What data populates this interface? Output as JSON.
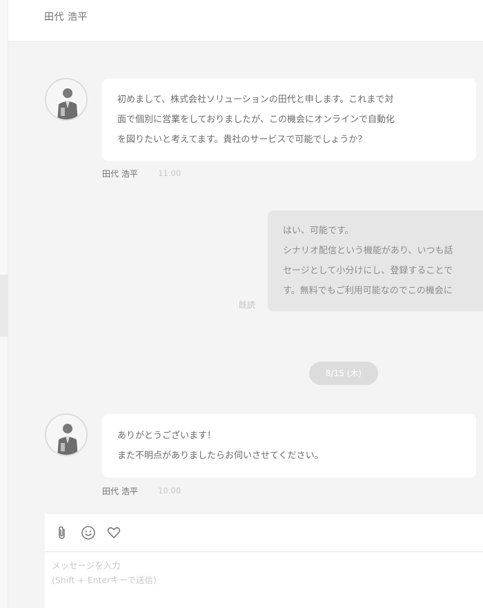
{
  "header": {
    "title": "田代 浩平"
  },
  "messages": [
    {
      "direction": "incoming",
      "lines": [
        "初めまして、株式会社ソリューションの田代と申します。これまで対",
        "面で個別に営業をしておりましたが、この機会にオンラインで自動化",
        "を図りたいと考えてます。貴社のサービスで可能でしょうか？"
      ],
      "sender": "田代 浩平",
      "time": "11:00"
    },
    {
      "direction": "outgoing",
      "lines": [
        "はい、可能です。",
        "シナリオ配信という機能があり、いつも話",
        "セージとして小分けにし、登録することで",
        "す。無料でもご利用可能なのでこの機会に"
      ],
      "read_label": "既読"
    },
    {
      "direction": "incoming",
      "lines": [
        "ありがとうございます！",
        "また不明点がありましたらお伺いさせてください。"
      ],
      "sender": "田代 浩平",
      "time": "10:00"
    }
  ],
  "date_separator": "8/15 (木)",
  "composer": {
    "placeholder": "メッセージを入力\n(Shift + Enterキーで送信)",
    "value": "",
    "icons": [
      "paperclip-icon",
      "smiley-icon",
      "heart-icon"
    ]
  },
  "colors": {
    "background": "#f4f4f4",
    "incoming_bubble": "#ffffff",
    "outgoing_bubble": "#e6e6e6",
    "date_pill": "#dcdcdc"
  }
}
